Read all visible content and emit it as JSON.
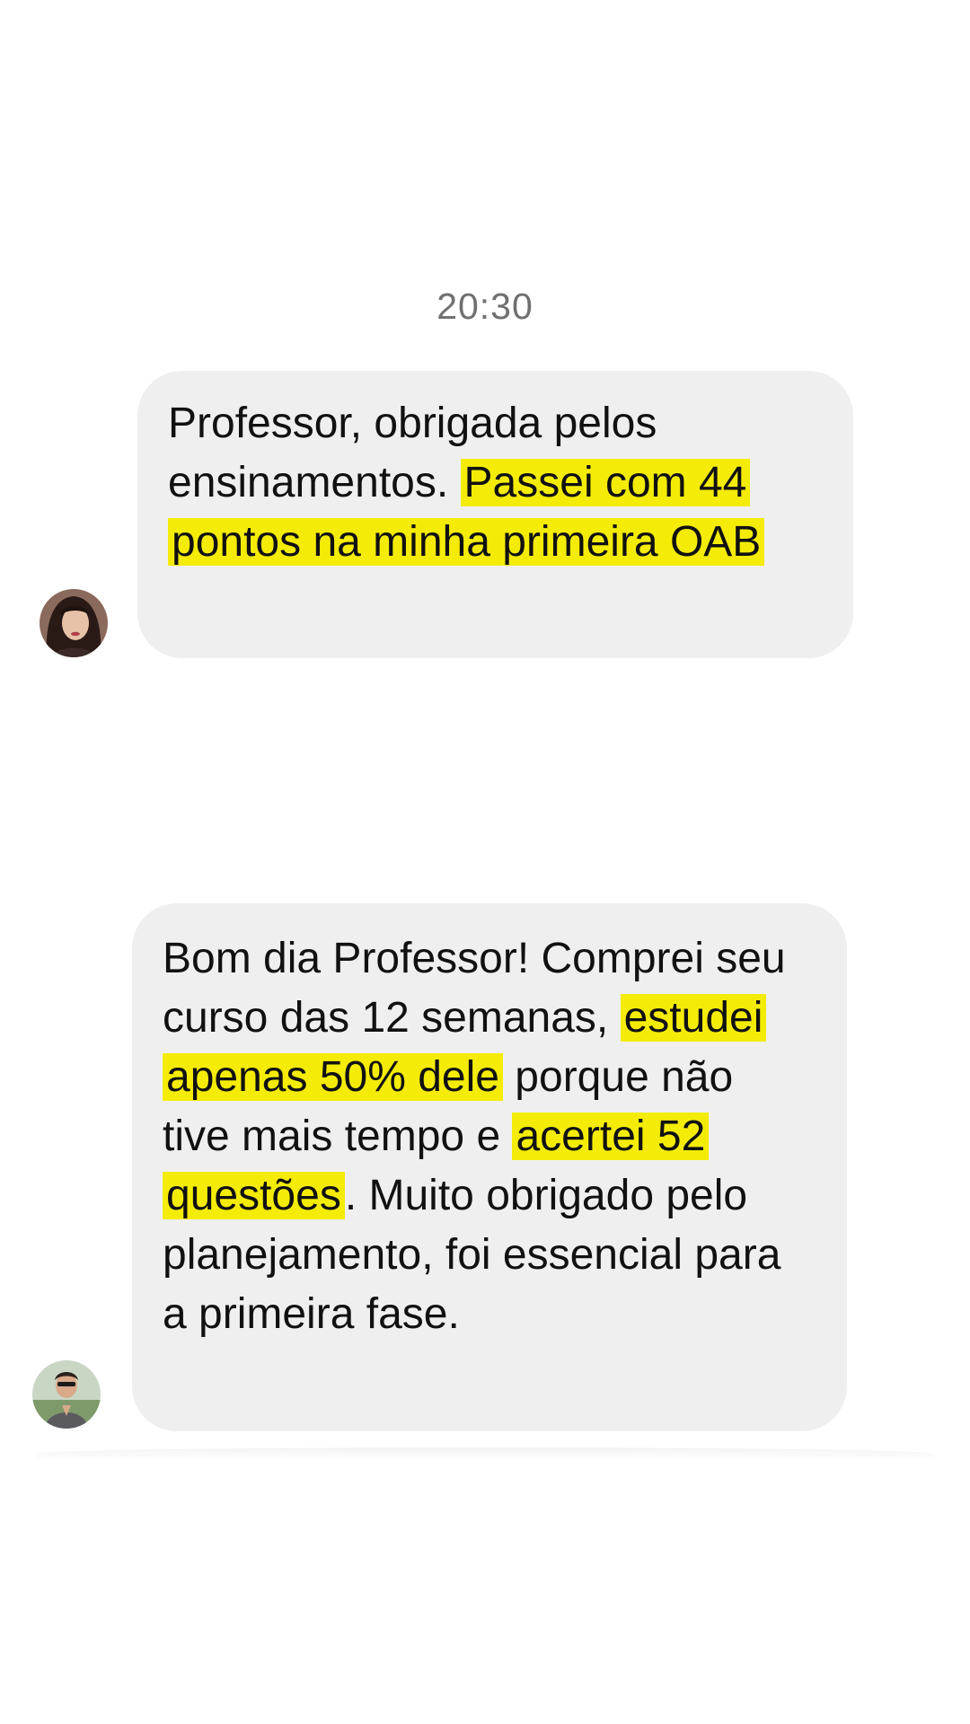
{
  "timestamp": "20:30",
  "messages": [
    {
      "sender": "student-1",
      "segments": [
        {
          "text": "Professor, obrigada pelos ensinamentos. ",
          "highlight": false
        },
        {
          "text": "Passei com 44 pontos na minha primeira OAB",
          "highlight": true
        }
      ]
    },
    {
      "sender": "student-2",
      "segments": [
        {
          "text": "Bom dia Professor! Comprei seu curso das 12 semanas, ",
          "highlight": false
        },
        {
          "text": "estudei apenas 50% dele",
          "highlight": true
        },
        {
          "text": " porque não tive mais tempo e ",
          "highlight": false
        },
        {
          "text": "acertei 52 questões",
          "highlight": true
        },
        {
          "text": ". Muito obrigado pelo planejamento, foi essencial para a primeira fase.",
          "highlight": false
        }
      ]
    }
  ],
  "colors": {
    "bubble_background": "#efefef",
    "highlight": "#f4ec06",
    "timestamp_text": "#707070"
  },
  "icons": {
    "avatar_1": "profile-photo-woman",
    "avatar_2": "profile-photo-man"
  }
}
